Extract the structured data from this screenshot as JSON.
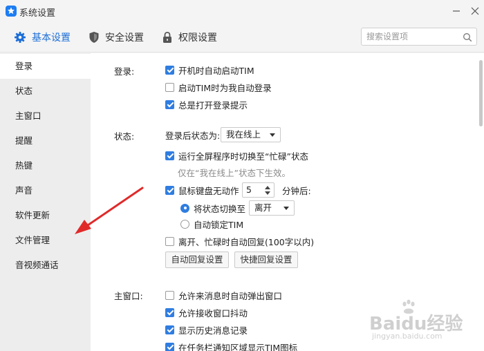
{
  "window": {
    "title": "系统设置"
  },
  "tabs": [
    {
      "label": "基本设置",
      "icon": "gear-icon",
      "active": true
    },
    {
      "label": "安全设置",
      "icon": "shield-icon",
      "active": false
    },
    {
      "label": "权限设置",
      "icon": "lock-icon",
      "active": false
    }
  ],
  "search": {
    "placeholder": "搜索设置项"
  },
  "sidebar": {
    "items": [
      {
        "label": "登录",
        "active": true
      },
      {
        "label": "状态",
        "active": false
      },
      {
        "label": "主窗口",
        "active": false
      },
      {
        "label": "提醒",
        "active": false
      },
      {
        "label": "热键",
        "active": false
      },
      {
        "label": "声音",
        "active": false
      },
      {
        "label": "软件更新",
        "active": false
      },
      {
        "label": "文件管理",
        "active": false
      },
      {
        "label": "音视频通话",
        "active": false
      }
    ]
  },
  "login": {
    "label": "登录:",
    "options": [
      {
        "label": "开机时自动启动TIM",
        "checked": true
      },
      {
        "label": "启动TIM时为我自动登录",
        "checked": false
      },
      {
        "label": "总是打开登录提示",
        "checked": true
      }
    ]
  },
  "status": {
    "label": "状态:",
    "after_login_label": "登录后状态为:",
    "after_login_value": "我在线上",
    "fullscreen": {
      "label": "运行全屏程序时切换至“忙碌”状态",
      "checked": true
    },
    "fullscreen_hint": "仅在“我在线上”状态下生效。",
    "idle": {
      "label": "鼠标键盘无动作",
      "checked": true,
      "minutes": "5",
      "suffix": "分钟后:"
    },
    "switch_to": {
      "label": "将状态切换至",
      "value": "离开",
      "selected": true
    },
    "auto_lock": {
      "label": "自动锁定TIM",
      "selected": false
    },
    "auto_reply": {
      "label": "离开、忙碌时自动回复(100字以内)",
      "checked": false
    },
    "buttons": {
      "auto_reply_settings": "自动回复设置",
      "quick_reply_settings": "快捷回复设置"
    }
  },
  "main_window": {
    "label": "主窗口:",
    "options": [
      {
        "label": "允许来消息时自动弹出窗口",
        "checked": false
      },
      {
        "label": "允许接收窗口抖动",
        "checked": true
      },
      {
        "label": "显示历史消息记录",
        "checked": true
      },
      {
        "label": "在任务栏通知区域显示TIM图标",
        "checked": true
      }
    ]
  },
  "watermark": {
    "brand": "Baidu经验",
    "url": "jingyan.baidu.com"
  },
  "colors": {
    "accent": "#1d6fd8",
    "checkbox": "#2f7de1",
    "arrow": "#e02a2a",
    "sidebar_bg": "#ededed"
  }
}
